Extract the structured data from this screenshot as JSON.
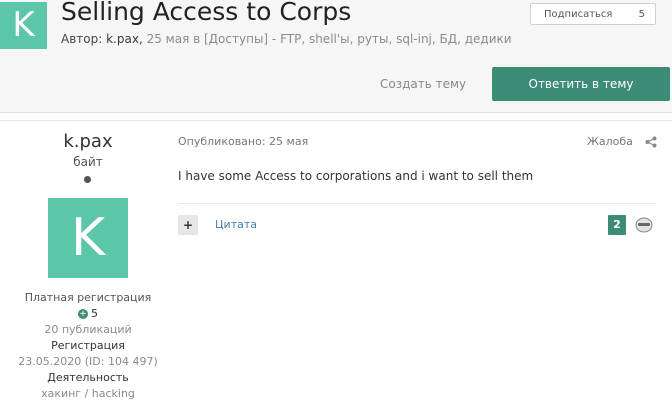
{
  "thread": {
    "avatar_letter": "K",
    "title": "Selling Access to Corps",
    "author_label": "Автор:",
    "author": "k.pax,",
    "date": "25 мая в [Доступы]",
    "tags": "- FTP, shell'ы, руты, sql-inj, БД, дедики"
  },
  "subscribe": {
    "label": "Подписаться",
    "count": "5"
  },
  "actions": {
    "create_topic": "Создать тему",
    "reply": "Ответить в тему"
  },
  "author_panel": {
    "name": "k.pax",
    "rank": "байт",
    "avatar_letter": "K",
    "group": "Платная регистрация",
    "reputation": "5",
    "posts": "20 публикаций",
    "reg_label": "Регистрация",
    "reg_date": "23.05.2020 (ID: 104 497)",
    "activity_label": "Деятельность",
    "activity": "хакинг / hacking"
  },
  "post": {
    "published": "Опубликовано: 25 мая",
    "report": "Жалоба",
    "body": "I have some Access to corporations  and i want to sell them",
    "quote_label": "Цитата",
    "reaction_count": "2"
  },
  "colors": {
    "accent": "#5cc6a8",
    "button": "#3d8c77"
  }
}
